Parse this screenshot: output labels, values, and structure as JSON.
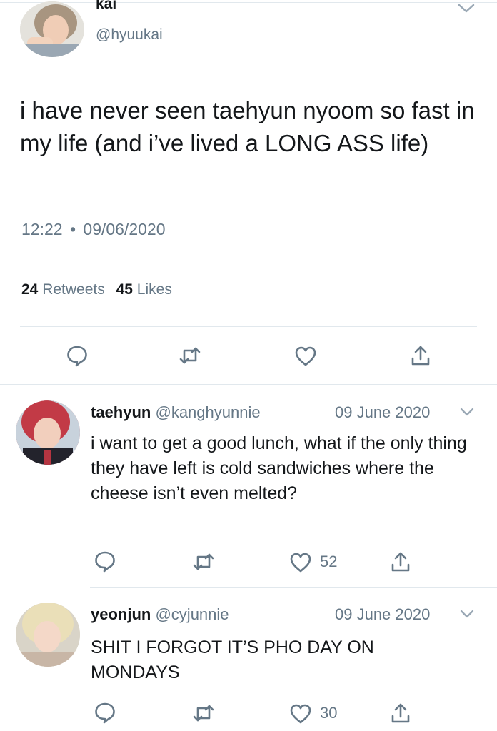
{
  "main_tweet": {
    "display_name": "kai",
    "handle": "@hyuukai",
    "text": "i have never seen taehyun nyoom so fast in my life (and i’ve lived a LONG ASS life)",
    "time": "12:22",
    "separator": "•",
    "date": "09/06/2020",
    "retweets_count": "24",
    "retweets_label": "Retweets",
    "likes_count": "45",
    "likes_label": "Likes"
  },
  "replies": [
    {
      "display_name": "taehyun",
      "handle": "@kanghyunnie",
      "date": "09 June 2020",
      "text": "i want to get a good lunch, what if the only thing they have left is cold sandwiches where the cheese isn’t even melted?",
      "likes": "52"
    },
    {
      "display_name": "yeonjun",
      "handle": "@cyjunnie",
      "date": "09 June 2020",
      "text": "SHIT I FORGOT IT’S PHO DAY ON MONDAYS",
      "likes": "30"
    }
  ],
  "colors": {
    "text": "#14171a",
    "muted": "#657786",
    "divider": "#e1e8ed"
  },
  "icons": {
    "reply": "speech-bubble",
    "retweet": "retweet-arrows",
    "like": "heart-outline",
    "share": "share-arrow-up",
    "menu": "chevron-down"
  }
}
